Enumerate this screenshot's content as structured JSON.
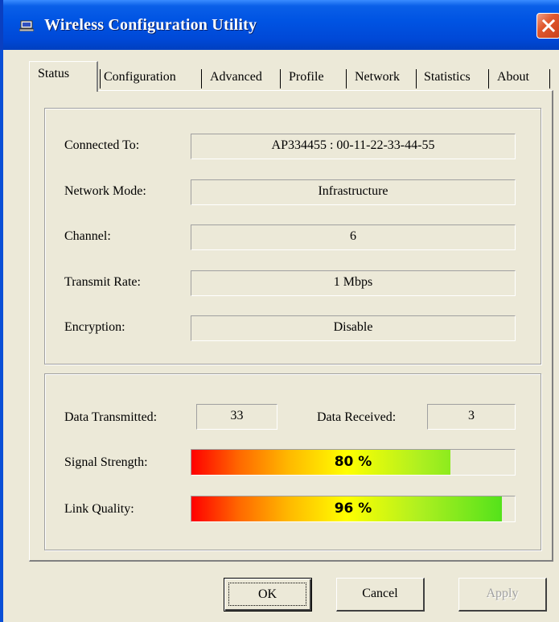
{
  "window": {
    "title": "Wireless Configuration Utility",
    "icon": "computer-icon"
  },
  "tabs": [
    "Status",
    "Configuration",
    "Advanced",
    "Profile",
    "Network",
    "Statistics",
    "About"
  ],
  "active_tab": "Status",
  "status": {
    "connected_to_label": "Connected To:",
    "connected_to_value": "AP334455 : 00-11-22-33-44-55",
    "network_mode_label": "Network Mode:",
    "network_mode_value": "Infrastructure",
    "channel_label": "Channel:",
    "channel_value": "6",
    "transmit_rate_label": "Transmit Rate:",
    "transmit_rate_value": "1 Mbps",
    "encryption_label": "Encryption:",
    "encryption_value": "Disable"
  },
  "stats": {
    "data_transmitted_label": "Data Transmitted:",
    "data_transmitted_value": "33",
    "data_received_label": "Data Received:",
    "data_received_value": "3",
    "signal_strength_label": "Signal Strength:",
    "signal_strength_text": "80 %",
    "signal_strength_level": 0.8,
    "link_quality_label": "Link Quality:",
    "link_quality_text": "96 %",
    "link_quality_level": 0.96
  },
  "buttons": {
    "ok": "OK",
    "cancel": "Cancel",
    "apply": "Apply"
  },
  "colors": {
    "titlebar": "#0054E3",
    "dialog_bg": "#ECE9D8",
    "close_button": "#E0582E"
  }
}
